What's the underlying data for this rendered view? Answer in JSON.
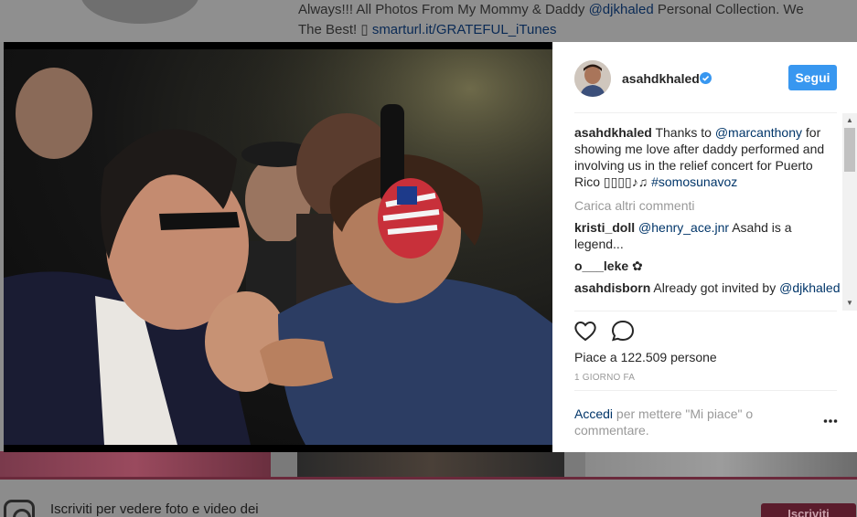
{
  "background": {
    "caption_line1_prefix": "Always!!! All Photos From My Mommy & Daddy ",
    "caption_line1_mention": "@djkhaled",
    "caption_line1_suffix": " Personal Collection. We",
    "caption_line2_prefix": "The Best! ",
    "caption_line2_glyph": "▯",
    "caption_line2_link": "smarturl.it/GRATEFUL_iTunes",
    "signup_text": "Iscriviti per vedere foto e video dei",
    "signup_button": "Iscriviti"
  },
  "post": {
    "username": "asahdkhaled",
    "follow_label": "Segui",
    "caption": {
      "user": "asahdkhaled",
      "text_before": " Thanks to ",
      "mention": "@marcanthony",
      "text_after": " for showing me love after daddy performed and involving us in the relief concert for Puerto Rico ▯▯▯▯♪♫ ",
      "hashtag": "#somosunavoz"
    },
    "load_more": "Carica altri commenti",
    "comments": [
      {
        "user": "kristi_doll",
        "mention": "@henry_ace.jnr",
        "text": " Asahd is a legend..."
      },
      {
        "user": "o___leke",
        "mention": "",
        "text": " ✿"
      },
      {
        "user": "asahdisborn",
        "mention": "",
        "text": " Already got invited by ",
        "trailing_mention": "@djkhaled"
      }
    ],
    "likes": "Piace a 122.509 persone",
    "timestamp": "1 GIORNO FA",
    "login_link": "Accedi",
    "login_text": " per mettere \"Mi piace\" o commentare.",
    "more_glyph": "•••"
  },
  "colors": {
    "accent": "#3897f0",
    "link": "#003569",
    "verified": "#3897f0",
    "muted": "#999999"
  },
  "icons": [
    "verified-badge-icon",
    "heart-icon",
    "comment-bubble-icon",
    "more-options-icon",
    "instagram-logo-icon",
    "scroll-up-icon",
    "scroll-down-icon"
  ]
}
